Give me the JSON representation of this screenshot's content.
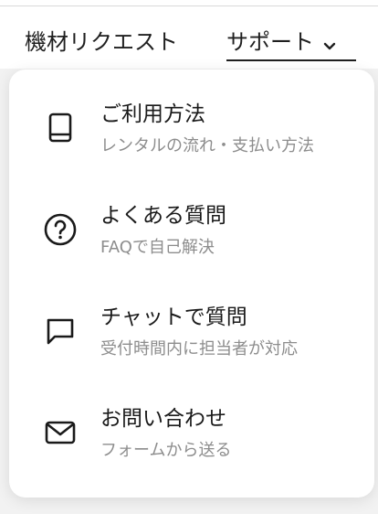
{
  "header": {
    "equipment_request_label": "機材リクエスト",
    "support_label": "サポート",
    "support_chevron_icon": "chevron-down-icon"
  },
  "support_menu": {
    "items": [
      {
        "title": "ご利用方法",
        "description": "レンタルの流れ・支払い方法",
        "icon": "book-icon"
      },
      {
        "title": "よくある質問",
        "description": "FAQで自己解決",
        "icon": "question-circle-icon"
      },
      {
        "title": "チャットで質問",
        "description": "受付時間内に担当者が対応",
        "icon": "chat-bubble-icon"
      },
      {
        "title": "お問い合わせ",
        "description": "フォームから送る",
        "icon": "envelope-icon"
      }
    ]
  },
  "colors": {
    "text_primary": "#1a1a1a",
    "text_secondary": "#8d8d8d",
    "background": "#f2f2f2",
    "panel": "#ffffff"
  }
}
